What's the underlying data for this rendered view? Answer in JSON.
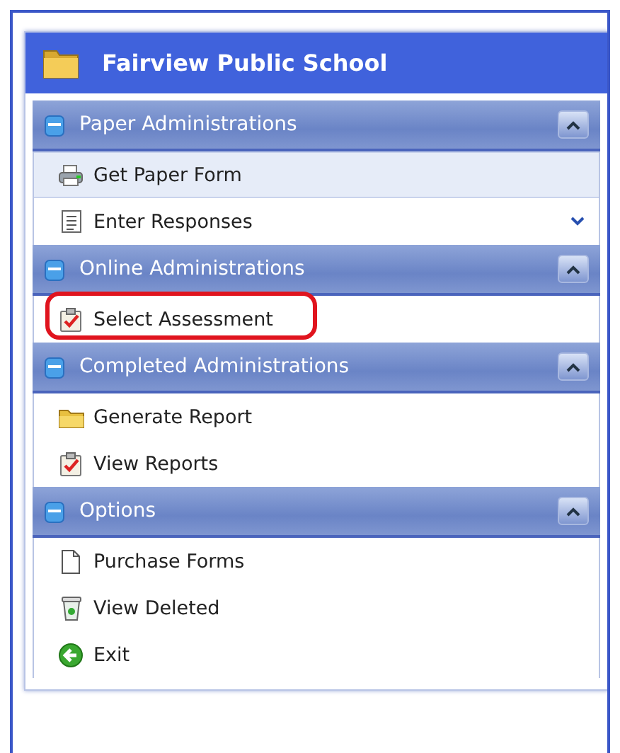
{
  "panel": {
    "title": "Fairview Public School"
  },
  "sections": [
    {
      "title": "Paper Administrations",
      "expanded": true,
      "items": [
        {
          "label": "Get Paper Form",
          "kind": "printer",
          "selected": true,
          "circled": false,
          "submenu": false
        },
        {
          "label": "Enter Responses",
          "kind": "form",
          "selected": false,
          "circled": false,
          "submenu": true
        }
      ]
    },
    {
      "title": "Online Administrations",
      "expanded": true,
      "items": [
        {
          "label": "Select Assessment",
          "kind": "checklist",
          "selected": false,
          "circled": true,
          "submenu": false
        }
      ]
    },
    {
      "title": "Completed Administrations",
      "expanded": true,
      "items": [
        {
          "label": "Generate Report",
          "kind": "folder",
          "selected": false,
          "circled": false,
          "submenu": false
        },
        {
          "label": "View Reports",
          "kind": "checklist",
          "selected": false,
          "circled": false,
          "submenu": false
        }
      ]
    },
    {
      "title": "Options",
      "expanded": true,
      "items": [
        {
          "label": "Purchase Forms",
          "kind": "page",
          "selected": false,
          "circled": false,
          "submenu": false
        },
        {
          "label": "View Deleted",
          "kind": "bin",
          "selected": false,
          "circled": false,
          "submenu": false
        },
        {
          "label": "Exit",
          "kind": "exit",
          "selected": false,
          "circled": false,
          "submenu": false
        }
      ]
    }
  ]
}
